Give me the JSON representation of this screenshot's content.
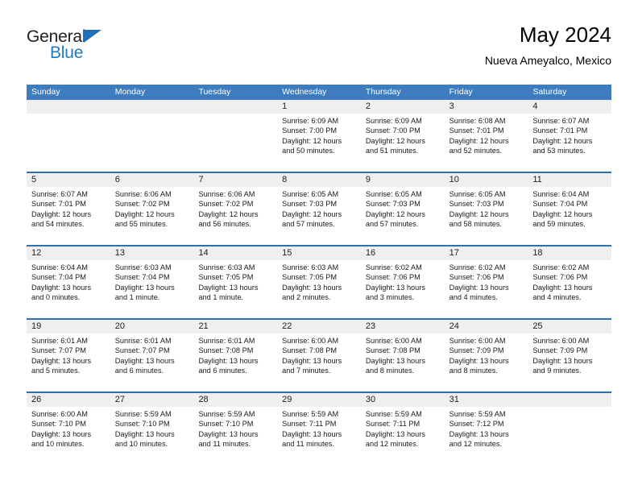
{
  "brand": {
    "word1": "General",
    "word2": "Blue",
    "triangle_icon": "brand-triangle-icon",
    "accent_color": "#1f7ac4"
  },
  "header": {
    "title": "May 2024",
    "subtitle": "Nueva Ameyalco, Mexico"
  },
  "colors": {
    "header_row_bg": "#3c7cbf",
    "week_divider": "#2f6fae",
    "day_number_bg": "#efefef",
    "text": "#1a1a1a"
  },
  "weekdays": [
    "Sunday",
    "Monday",
    "Tuesday",
    "Wednesday",
    "Thursday",
    "Friday",
    "Saturday"
  ],
  "weeks": [
    [
      {
        "day": "",
        "sunrise": "",
        "sunset": "",
        "daylight1": "",
        "daylight2": "",
        "empty": true
      },
      {
        "day": "",
        "sunrise": "",
        "sunset": "",
        "daylight1": "",
        "daylight2": "",
        "empty": true
      },
      {
        "day": "",
        "sunrise": "",
        "sunset": "",
        "daylight1": "",
        "daylight2": "",
        "empty": true
      },
      {
        "day": "1",
        "sunrise": "Sunrise: 6:09 AM",
        "sunset": "Sunset: 7:00 PM",
        "daylight1": "Daylight: 12 hours",
        "daylight2": "and 50 minutes."
      },
      {
        "day": "2",
        "sunrise": "Sunrise: 6:09 AM",
        "sunset": "Sunset: 7:00 PM",
        "daylight1": "Daylight: 12 hours",
        "daylight2": "and 51 minutes."
      },
      {
        "day": "3",
        "sunrise": "Sunrise: 6:08 AM",
        "sunset": "Sunset: 7:01 PM",
        "daylight1": "Daylight: 12 hours",
        "daylight2": "and 52 minutes."
      },
      {
        "day": "4",
        "sunrise": "Sunrise: 6:07 AM",
        "sunset": "Sunset: 7:01 PM",
        "daylight1": "Daylight: 12 hours",
        "daylight2": "and 53 minutes."
      }
    ],
    [
      {
        "day": "5",
        "sunrise": "Sunrise: 6:07 AM",
        "sunset": "Sunset: 7:01 PM",
        "daylight1": "Daylight: 12 hours",
        "daylight2": "and 54 minutes."
      },
      {
        "day": "6",
        "sunrise": "Sunrise: 6:06 AM",
        "sunset": "Sunset: 7:02 PM",
        "daylight1": "Daylight: 12 hours",
        "daylight2": "and 55 minutes."
      },
      {
        "day": "7",
        "sunrise": "Sunrise: 6:06 AM",
        "sunset": "Sunset: 7:02 PM",
        "daylight1": "Daylight: 12 hours",
        "daylight2": "and 56 minutes."
      },
      {
        "day": "8",
        "sunrise": "Sunrise: 6:05 AM",
        "sunset": "Sunset: 7:03 PM",
        "daylight1": "Daylight: 12 hours",
        "daylight2": "and 57 minutes."
      },
      {
        "day": "9",
        "sunrise": "Sunrise: 6:05 AM",
        "sunset": "Sunset: 7:03 PM",
        "daylight1": "Daylight: 12 hours",
        "daylight2": "and 57 minutes."
      },
      {
        "day": "10",
        "sunrise": "Sunrise: 6:05 AM",
        "sunset": "Sunset: 7:03 PM",
        "daylight1": "Daylight: 12 hours",
        "daylight2": "and 58 minutes."
      },
      {
        "day": "11",
        "sunrise": "Sunrise: 6:04 AM",
        "sunset": "Sunset: 7:04 PM",
        "daylight1": "Daylight: 12 hours",
        "daylight2": "and 59 minutes."
      }
    ],
    [
      {
        "day": "12",
        "sunrise": "Sunrise: 6:04 AM",
        "sunset": "Sunset: 7:04 PM",
        "daylight1": "Daylight: 13 hours",
        "daylight2": "and 0 minutes."
      },
      {
        "day": "13",
        "sunrise": "Sunrise: 6:03 AM",
        "sunset": "Sunset: 7:04 PM",
        "daylight1": "Daylight: 13 hours",
        "daylight2": "and 1 minute."
      },
      {
        "day": "14",
        "sunrise": "Sunrise: 6:03 AM",
        "sunset": "Sunset: 7:05 PM",
        "daylight1": "Daylight: 13 hours",
        "daylight2": "and 1 minute."
      },
      {
        "day": "15",
        "sunrise": "Sunrise: 6:03 AM",
        "sunset": "Sunset: 7:05 PM",
        "daylight1": "Daylight: 13 hours",
        "daylight2": "and 2 minutes."
      },
      {
        "day": "16",
        "sunrise": "Sunrise: 6:02 AM",
        "sunset": "Sunset: 7:06 PM",
        "daylight1": "Daylight: 13 hours",
        "daylight2": "and 3 minutes."
      },
      {
        "day": "17",
        "sunrise": "Sunrise: 6:02 AM",
        "sunset": "Sunset: 7:06 PM",
        "daylight1": "Daylight: 13 hours",
        "daylight2": "and 4 minutes."
      },
      {
        "day": "18",
        "sunrise": "Sunrise: 6:02 AM",
        "sunset": "Sunset: 7:06 PM",
        "daylight1": "Daylight: 13 hours",
        "daylight2": "and 4 minutes."
      }
    ],
    [
      {
        "day": "19",
        "sunrise": "Sunrise: 6:01 AM",
        "sunset": "Sunset: 7:07 PM",
        "daylight1": "Daylight: 13 hours",
        "daylight2": "and 5 minutes."
      },
      {
        "day": "20",
        "sunrise": "Sunrise: 6:01 AM",
        "sunset": "Sunset: 7:07 PM",
        "daylight1": "Daylight: 13 hours",
        "daylight2": "and 6 minutes."
      },
      {
        "day": "21",
        "sunrise": "Sunrise: 6:01 AM",
        "sunset": "Sunset: 7:08 PM",
        "daylight1": "Daylight: 13 hours",
        "daylight2": "and 6 minutes."
      },
      {
        "day": "22",
        "sunrise": "Sunrise: 6:00 AM",
        "sunset": "Sunset: 7:08 PM",
        "daylight1": "Daylight: 13 hours",
        "daylight2": "and 7 minutes."
      },
      {
        "day": "23",
        "sunrise": "Sunrise: 6:00 AM",
        "sunset": "Sunset: 7:08 PM",
        "daylight1": "Daylight: 13 hours",
        "daylight2": "and 8 minutes."
      },
      {
        "day": "24",
        "sunrise": "Sunrise: 6:00 AM",
        "sunset": "Sunset: 7:09 PM",
        "daylight1": "Daylight: 13 hours",
        "daylight2": "and 8 minutes."
      },
      {
        "day": "25",
        "sunrise": "Sunrise: 6:00 AM",
        "sunset": "Sunset: 7:09 PM",
        "daylight1": "Daylight: 13 hours",
        "daylight2": "and 9 minutes."
      }
    ],
    [
      {
        "day": "26",
        "sunrise": "Sunrise: 6:00 AM",
        "sunset": "Sunset: 7:10 PM",
        "daylight1": "Daylight: 13 hours",
        "daylight2": "and 10 minutes."
      },
      {
        "day": "27",
        "sunrise": "Sunrise: 5:59 AM",
        "sunset": "Sunset: 7:10 PM",
        "daylight1": "Daylight: 13 hours",
        "daylight2": "and 10 minutes."
      },
      {
        "day": "28",
        "sunrise": "Sunrise: 5:59 AM",
        "sunset": "Sunset: 7:10 PM",
        "daylight1": "Daylight: 13 hours",
        "daylight2": "and 11 minutes."
      },
      {
        "day": "29",
        "sunrise": "Sunrise: 5:59 AM",
        "sunset": "Sunset: 7:11 PM",
        "daylight1": "Daylight: 13 hours",
        "daylight2": "and 11 minutes."
      },
      {
        "day": "30",
        "sunrise": "Sunrise: 5:59 AM",
        "sunset": "Sunset: 7:11 PM",
        "daylight1": "Daylight: 13 hours",
        "daylight2": "and 12 minutes."
      },
      {
        "day": "31",
        "sunrise": "Sunrise: 5:59 AM",
        "sunset": "Sunset: 7:12 PM",
        "daylight1": "Daylight: 13 hours",
        "daylight2": "and 12 minutes."
      },
      {
        "day": "",
        "sunrise": "",
        "sunset": "",
        "daylight1": "",
        "daylight2": "",
        "empty": true
      }
    ]
  ]
}
